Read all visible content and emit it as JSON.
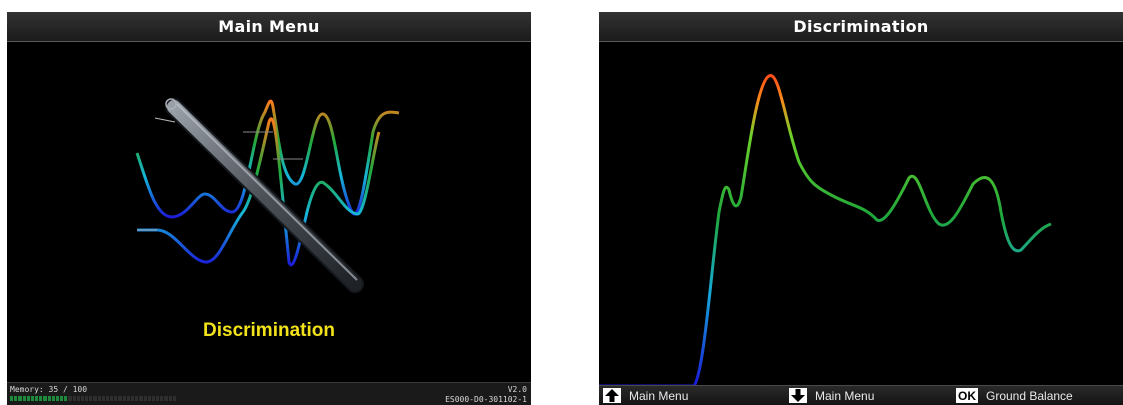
{
  "left_screen": {
    "title": "Main Menu",
    "menu_label": "Discrimination",
    "status": {
      "memory_text": "Memory: 35 / 100",
      "memory_fraction": 0.35,
      "version": "V2.0",
      "firmware": "ES000-D0-301102-1"
    },
    "icons": [
      "probe-icon",
      "signal-waves-icon"
    ]
  },
  "right_screen": {
    "title": "Discrimination",
    "footer": {
      "up_label": "Main Menu",
      "down_label": "Main Menu",
      "ok_key": "OK",
      "ok_label": "Ground Balance"
    }
  },
  "colors": {
    "background": "#000000",
    "title_bar": "#262626",
    "menu_label": "#f2e21a",
    "gradient_low": "#1a1ad8",
    "gradient_mid": "#1fa83a",
    "gradient_high": "#ff6a1a"
  }
}
